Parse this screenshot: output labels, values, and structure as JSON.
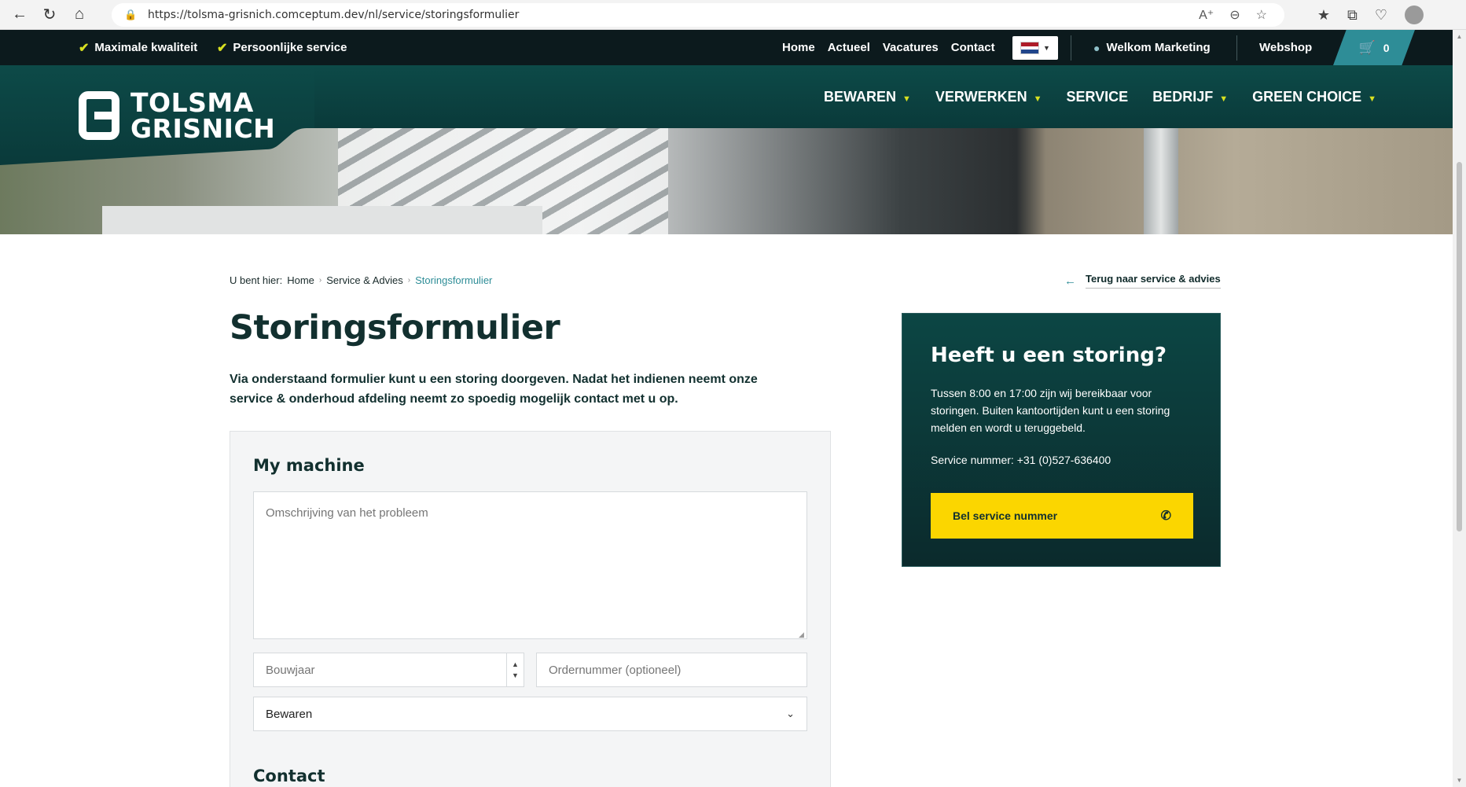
{
  "browser": {
    "url": "https://tolsma-grisnich.comceptum.dev/nl/service/storingsformulier"
  },
  "topbar": {
    "usps": [
      "Maximale kwaliteit",
      "Persoonlijke service"
    ],
    "nav": [
      "Home",
      "Actueel",
      "Vacatures",
      "Contact"
    ],
    "welcome": "Welkom Marketing",
    "webshop": "Webshop",
    "cart_count": "0"
  },
  "logo": {
    "line1": "TOLSMA",
    "line2": "GRISNICH"
  },
  "mainnav": {
    "items": [
      {
        "label": "BEWAREN",
        "dropdown": true
      },
      {
        "label": "VERWERKEN",
        "dropdown": true
      },
      {
        "label": "SERVICE",
        "dropdown": false
      },
      {
        "label": "BEDRIJF",
        "dropdown": true
      },
      {
        "label": "GREEN CHOICE",
        "dropdown": true
      }
    ]
  },
  "breadcrumb": {
    "prefix": "U bent hier:",
    "items": [
      "Home",
      "Service & Advies",
      "Storingsformulier"
    ]
  },
  "back_link": "Terug naar service & advies",
  "page": {
    "title": "Storingsformulier",
    "intro": "Via onderstaand formulier kunt u een storing doorgeven. Nadat het indienen neemt onze service & onderhoud afdeling neemt zo spoedig mogelijk contact met u op."
  },
  "form": {
    "section_machine": "My machine",
    "problem_placeholder": "Omschrijving van het probleem",
    "year_placeholder": "Bouwjaar",
    "order_placeholder": "Ordernummer (optioneel)",
    "category_selected": "Bewaren",
    "section_contact": "Contact"
  },
  "card": {
    "title": "Heeft u een storing?",
    "description": "Tussen 8:00 en 17:00 zijn wij bereikbaar voor storingen. Buiten kantoortijden kunt u een storing melden en wordt u teruggebeld.",
    "service_number": "Service nummer: +31 (0)527-636400",
    "call_button": "Bel service nummer"
  },
  "colors": {
    "dark_green": "#0c4644",
    "teal": "#2e8d97",
    "accent_yellow": "#fbd600",
    "check_green": "#d8e021"
  }
}
